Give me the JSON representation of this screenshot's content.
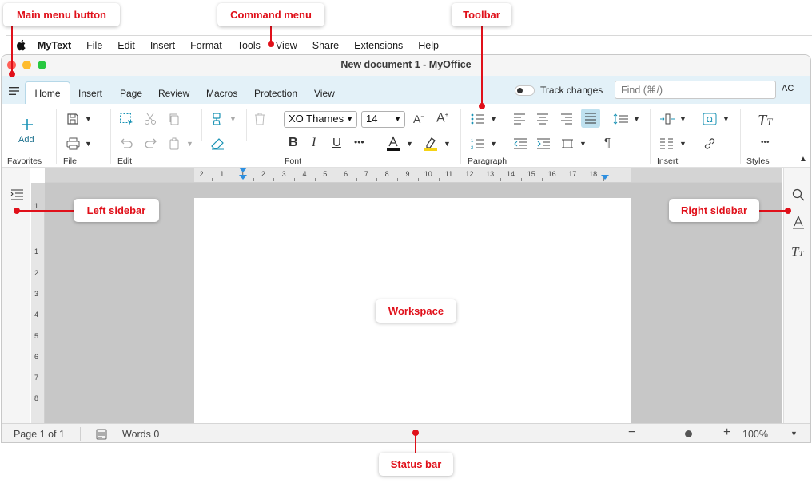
{
  "menubar": {
    "app_name": "MyText",
    "items": [
      "File",
      "Edit",
      "Insert",
      "Format",
      "Tools",
      "View",
      "Share",
      "Extensions",
      "Help"
    ]
  },
  "window": {
    "title": "New document 1 - MyOffice",
    "traffic_colors": {
      "close": "#ff5f57",
      "minimize": "#febc2e",
      "maximize": "#28c840"
    }
  },
  "tabs": {
    "items": [
      "Home",
      "Insert",
      "Page",
      "Review",
      "Macros",
      "Protection",
      "View"
    ],
    "active": "Home"
  },
  "track_changes_label": "Track changes",
  "find_placeholder": "Find (⌘/)",
  "user_initials": "AC",
  "toolbar": {
    "add_label": "Add",
    "groups": [
      "Favorites",
      "File",
      "Edit",
      "Font",
      "Paragraph",
      "Insert",
      "Styles"
    ],
    "font_name": "XO Thames",
    "font_size": "14",
    "accent_color": "#1a93b5",
    "highlight_color": "#f5d315"
  },
  "ruler": {
    "h_ticks": [
      "2",
      "1",
      "1",
      "2",
      "3",
      "4",
      "5",
      "6",
      "7",
      "8",
      "9",
      "10",
      "11",
      "12",
      "13",
      "14",
      "15",
      "16",
      "17",
      "18"
    ],
    "v_ticks": [
      "1",
      "1",
      "2",
      "3",
      "4",
      "5",
      "6",
      "7",
      "8"
    ]
  },
  "status": {
    "page": "Page 1 of 1",
    "words": "Words 0",
    "zoom": "100%",
    "zoom_fraction": 0.6
  },
  "annotations": {
    "main_menu": "Main menu button",
    "command_menu": "Command menu",
    "toolbar": "Toolbar",
    "left_sidebar": "Left sidebar",
    "right_sidebar": "Right sidebar",
    "workspace": "Workspace",
    "status_bar": "Status bar",
    "color": "#e0101a"
  }
}
